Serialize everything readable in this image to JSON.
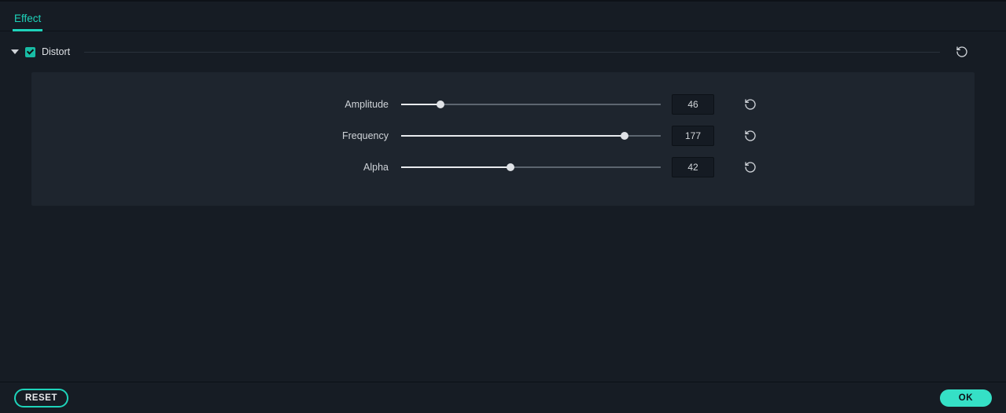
{
  "tabs": {
    "effect": "Effect"
  },
  "section": {
    "name": "Distort",
    "checked": true
  },
  "params": [
    {
      "label": "Amplitude",
      "value": 46,
      "max": 300,
      "pct": 15
    },
    {
      "label": "Frequency",
      "value": 177,
      "max": 200,
      "pct": 86
    },
    {
      "label": "Alpha",
      "value": 42,
      "max": 100,
      "pct": 42
    }
  ],
  "footer": {
    "reset": "RESET",
    "ok": "OK"
  },
  "colors": {
    "accent": "#1ed3ba",
    "bg": "#161c24",
    "panel": "#1e252e"
  }
}
